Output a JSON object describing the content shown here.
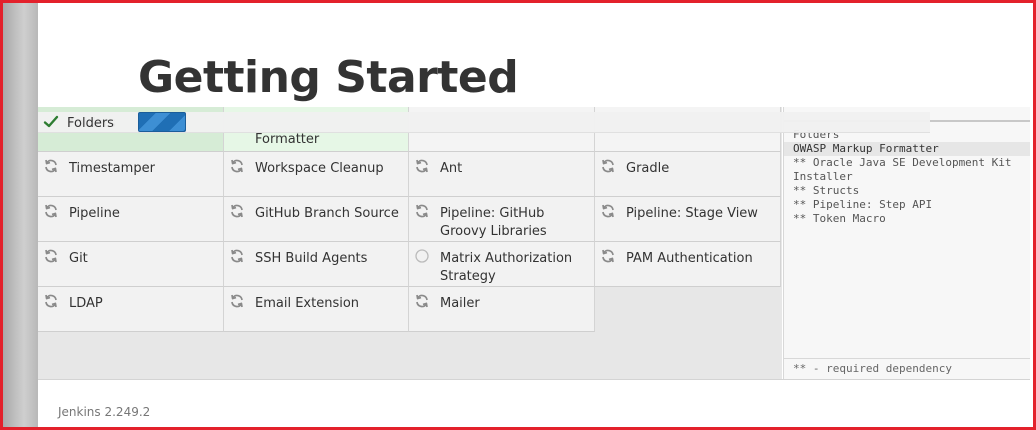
{
  "page": {
    "title": "Getting Started"
  },
  "plugins": [
    {
      "label": "Folders",
      "status": "installed"
    },
    {
      "label": "Formatter",
      "status": "installed"
    },
    {
      "label": "",
      "status": "none"
    },
    {
      "label": "",
      "status": "none"
    },
    {
      "label": "Timestamper",
      "status": "pending"
    },
    {
      "label": "Workspace Cleanup",
      "status": "pending"
    },
    {
      "label": "Ant",
      "status": "pending"
    },
    {
      "label": "Gradle",
      "status": "pending"
    },
    {
      "label": "Pipeline",
      "status": "pending"
    },
    {
      "label": "GitHub Branch Source",
      "status": "pending"
    },
    {
      "label": "Pipeline: GitHub Groovy Libraries",
      "status": "pending"
    },
    {
      "label": "Pipeline: Stage View",
      "status": "pending"
    },
    {
      "label": "Git",
      "status": "pending"
    },
    {
      "label": "SSH Build Agents",
      "status": "pending"
    },
    {
      "label": "Matrix Authorization Strategy",
      "status": "waiting"
    },
    {
      "label": "PAM Authentication",
      "status": "pending"
    },
    {
      "label": "LDAP",
      "status": "pending"
    },
    {
      "label": "Email Extension",
      "status": "pending"
    },
    {
      "label": "Mailer",
      "status": "pending"
    }
  ],
  "progress": {
    "current_plugin": "Folders",
    "fraction": 0.16
  },
  "log": {
    "lines": [
      "Folders",
      "OWASP Markup Formatter",
      "** Oracle Java SE Development Kit",
      "Installer",
      "** Structs",
      "** Pipeline: Step API",
      "** Token Macro"
    ],
    "highlight_index": 1,
    "footer": "** - required dependency"
  },
  "footer": {
    "version": "Jenkins 2.249.2"
  },
  "colors": {
    "installed": "#d6ecd6",
    "accent": "#1f6fb5",
    "frame": "#e3212b",
    "check": "#2e7d32"
  },
  "icons": {
    "installed": "check-icon",
    "pending": "refresh-icon",
    "waiting": "circle-icon"
  }
}
